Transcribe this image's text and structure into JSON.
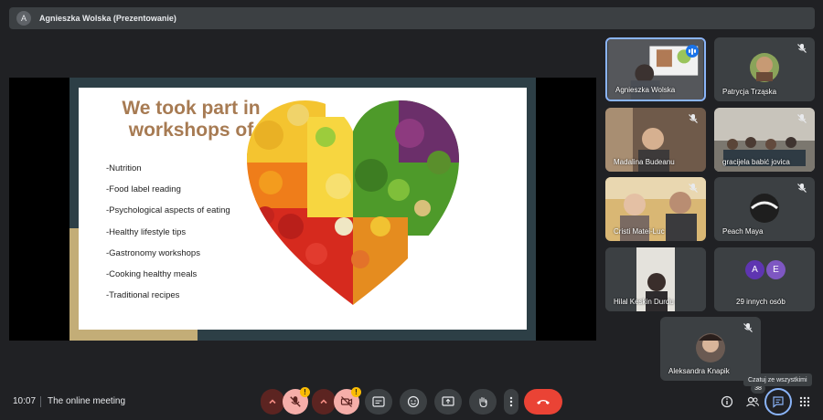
{
  "presenter_bar": {
    "initial": "A",
    "title": "Agnieszka Wolska (Prezentowanie)"
  },
  "slide": {
    "heading_line1": "We took part in",
    "heading_line2": "workshops of",
    "bullets": [
      "-Nutrition",
      "-Food label reading",
      "-Psychological aspects of eating",
      "-Healthy lifestyle tips",
      "-Gastronomy workshops",
      "-Cooking healthy meals",
      "-Traditional recipes"
    ]
  },
  "participants": [
    {
      "name": "Agnieszka Wolska"
    },
    {
      "name": "Patrycja Trząska"
    },
    {
      "name": "Madalina Budeanu"
    },
    {
      "name": "gracijela babić jovica"
    },
    {
      "name": "Cristi Matei-Luc"
    },
    {
      "name": "Peach Maya"
    },
    {
      "name": "Hilal Keskin Durdu"
    },
    {
      "name": "29 innych osób",
      "avatars": [
        "A",
        "E"
      ]
    },
    {
      "name": "Aleksandra Knapik"
    }
  ],
  "bottom_bar": {
    "time": "10:07",
    "meeting_name": "The online meeting",
    "people_count": "38",
    "chat_tooltip": "Czatuj ze wszystkimi"
  },
  "colors": {
    "background": "#202124",
    "tile": "#3c4043",
    "accent_blue": "#8ab4f8",
    "end_call_red": "#ea4335",
    "warning_yellow": "#fbbc04",
    "heading_brown": "#a77b53"
  }
}
